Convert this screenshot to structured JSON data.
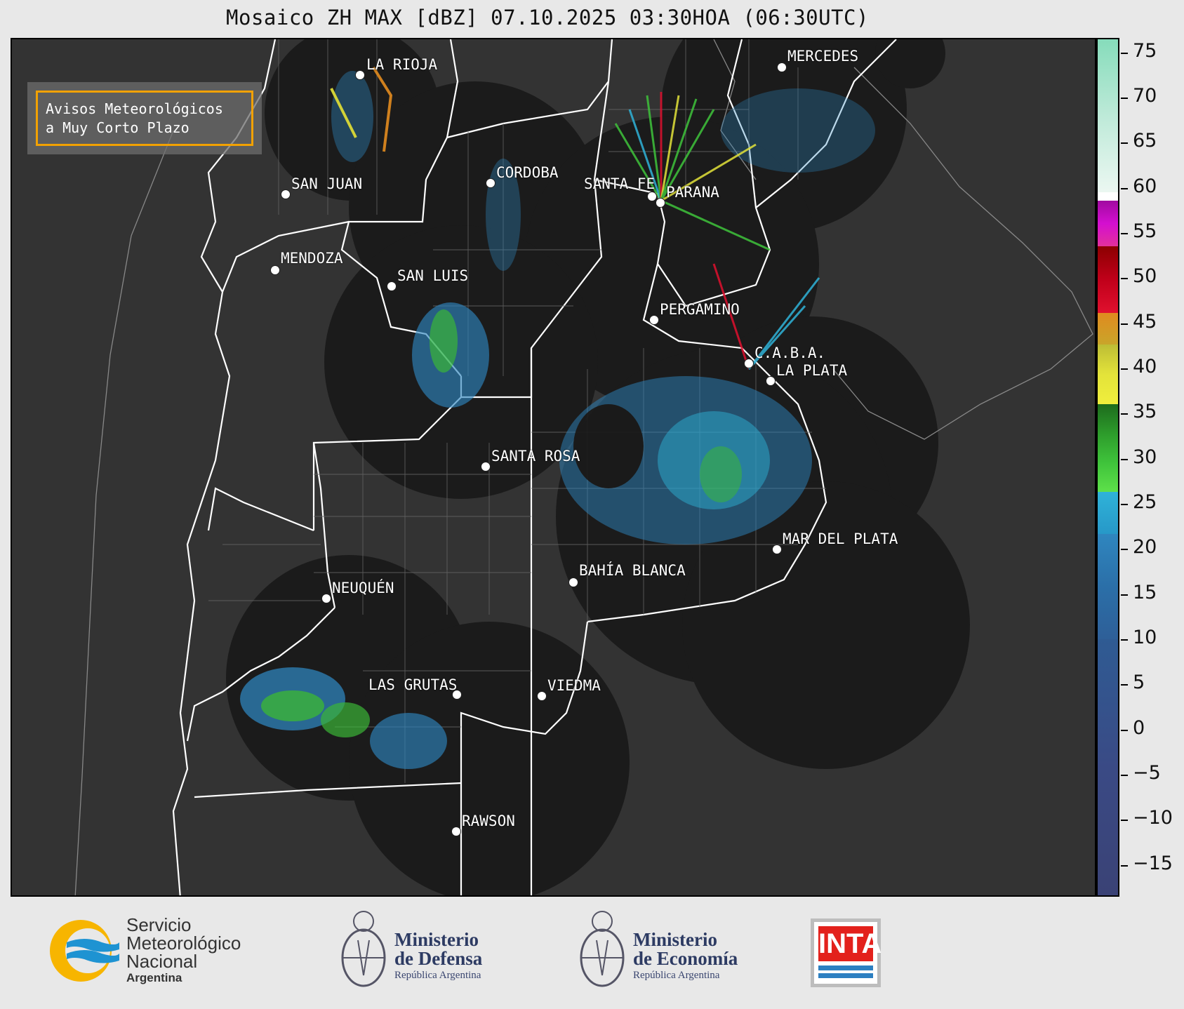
{
  "title": "Mosaico ZH MAX [dBZ] 07.10.2025 03:30HOA (06:30UTC)",
  "notice": {
    "line1": "Avisos Meteorológicos",
    "line2": "a Muy Corto Plazo",
    "border_color": "#f2a100"
  },
  "cities": [
    {
      "name": "LA RIOJA"
    },
    {
      "name": "MERCEDES"
    },
    {
      "name": "SAN JUAN"
    },
    {
      "name": "CORDOBA"
    },
    {
      "name": "SANTA FE"
    },
    {
      "name": "PARANA"
    },
    {
      "name": "MENDOZA"
    },
    {
      "name": "SAN LUIS"
    },
    {
      "name": "PERGAMINO"
    },
    {
      "name": "C.A.B.A."
    },
    {
      "name": "LA PLATA"
    },
    {
      "name": "SANTA ROSA"
    },
    {
      "name": "MAR DEL PLATA"
    },
    {
      "name": "BAHÍA BLANCA"
    },
    {
      "name": "NEUQUÉN"
    },
    {
      "name": "LAS GRUTAS"
    },
    {
      "name": "VIEDMA"
    },
    {
      "name": "RAWSON"
    }
  ],
  "colorbar": {
    "unit": "dBZ",
    "ticks": [
      "75",
      "70",
      "65",
      "60",
      "55",
      "50",
      "45",
      "40",
      "35",
      "30",
      "25",
      "20",
      "15",
      "10",
      "5",
      "0",
      "−5",
      "−10",
      "−15"
    ],
    "colors": {
      "low": "#3a4275",
      "blue": "#2f86bf",
      "cyan": "#2fb3d9",
      "green": "#3fc33b",
      "yellow": "#e3e33a",
      "orange": "#e08a1f",
      "red": "#e0102e",
      "magenta": "#d40fd0",
      "mint": "#86dcbb"
    }
  },
  "footer": {
    "smn": {
      "line1": "Servicio",
      "line2": "Meteorológico",
      "line3": "Nacional",
      "line4": "Argentina"
    },
    "defensa": {
      "line1": "Ministerio",
      "line2": "de Defensa",
      "line3": "República Argentina"
    },
    "economia": {
      "line1": "Ministerio",
      "line2": "de Economía",
      "line3": "República Argentina"
    },
    "inta": {
      "label": "INTA"
    }
  }
}
